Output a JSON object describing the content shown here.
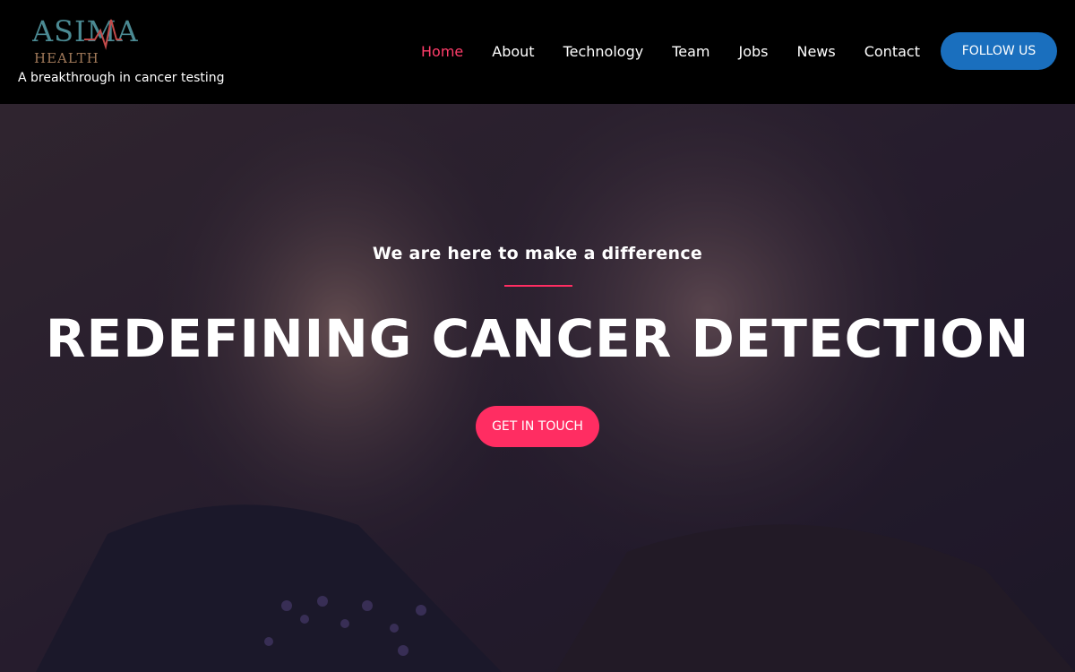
{
  "brand": {
    "logo_main": "ASIMA",
    "logo_sub": "HEALTH",
    "tagline": "A breakthrough in cancer testing",
    "logo_icon": "heartbeat-line-icon"
  },
  "nav": {
    "items": [
      {
        "label": "Home",
        "active": true
      },
      {
        "label": "About",
        "active": false
      },
      {
        "label": "Technology",
        "active": false
      },
      {
        "label": "Team",
        "active": false
      },
      {
        "label": "Jobs",
        "active": false
      },
      {
        "label": "News",
        "active": false
      },
      {
        "label": "Contact",
        "active": false
      }
    ],
    "follow_label": "FOLLOW US"
  },
  "hero": {
    "subtitle": "We are here to make a difference",
    "title": "REDEFINING CANCER DETECTION",
    "cta_label": "GET IN TOUCH"
  },
  "colors": {
    "header_bg": "#000000",
    "accent": "#ff2d62",
    "follow_button": "#1a6fbe",
    "nav_active": "#ff3d6a",
    "logo_teal": "#4b8a93",
    "logo_brown": "#a27a5a"
  }
}
